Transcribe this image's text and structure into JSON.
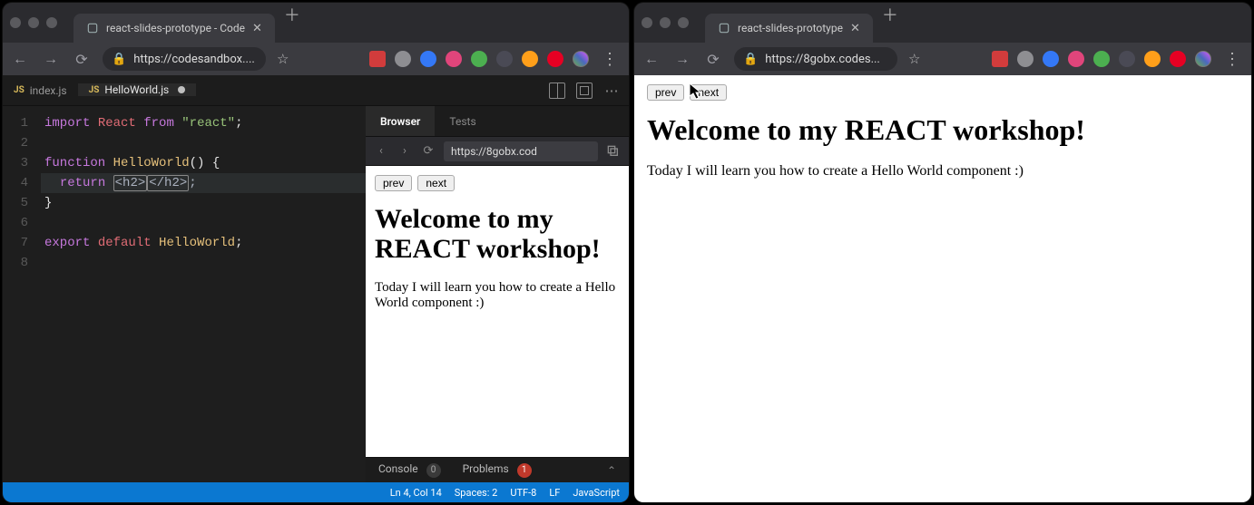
{
  "left_window": {
    "tab_title": "react-slides-prototype - Code",
    "url_display": "https://codesandbox....",
    "editor": {
      "tabs": [
        {
          "icon": "JS",
          "name": "index.js",
          "dirty": false,
          "active": false
        },
        {
          "icon": "JS",
          "name": "HelloWorld.js",
          "dirty": true,
          "active": true
        }
      ],
      "code_lines": [
        "import React from \"react\";",
        "",
        "function HelloWorld() {",
        "  return <h2></h2>;",
        "}",
        "",
        "export default HelloWorld;",
        ""
      ],
      "current_line": 4,
      "cursor_col": 14
    },
    "preview": {
      "tabs": {
        "browser": "Browser",
        "tests": "Tests"
      },
      "url": "https://8gobx.cod",
      "prev_label": "prev",
      "next_label": "next",
      "heading": "Welcome to my REACT workshop!",
      "paragraph": "Today I will learn you how to create a Hello World component :)"
    },
    "bottom_panel": {
      "console_label": "Console",
      "console_count": "0",
      "problems_label": "Problems",
      "problems_count": "1"
    },
    "status_bar": {
      "position": "Ln 4, Col 14",
      "spaces": "Spaces: 2",
      "encoding": "UTF-8",
      "eol": "LF",
      "language": "JavaScript"
    }
  },
  "right_window": {
    "tab_title": "react-slides-prototype",
    "url_display": "https://8gobx.codes...",
    "prev_label": "prev",
    "next_label": "next",
    "heading": "Welcome to my REACT workshop!",
    "paragraph": "Today I will learn you how to create a Hello World component :)"
  }
}
